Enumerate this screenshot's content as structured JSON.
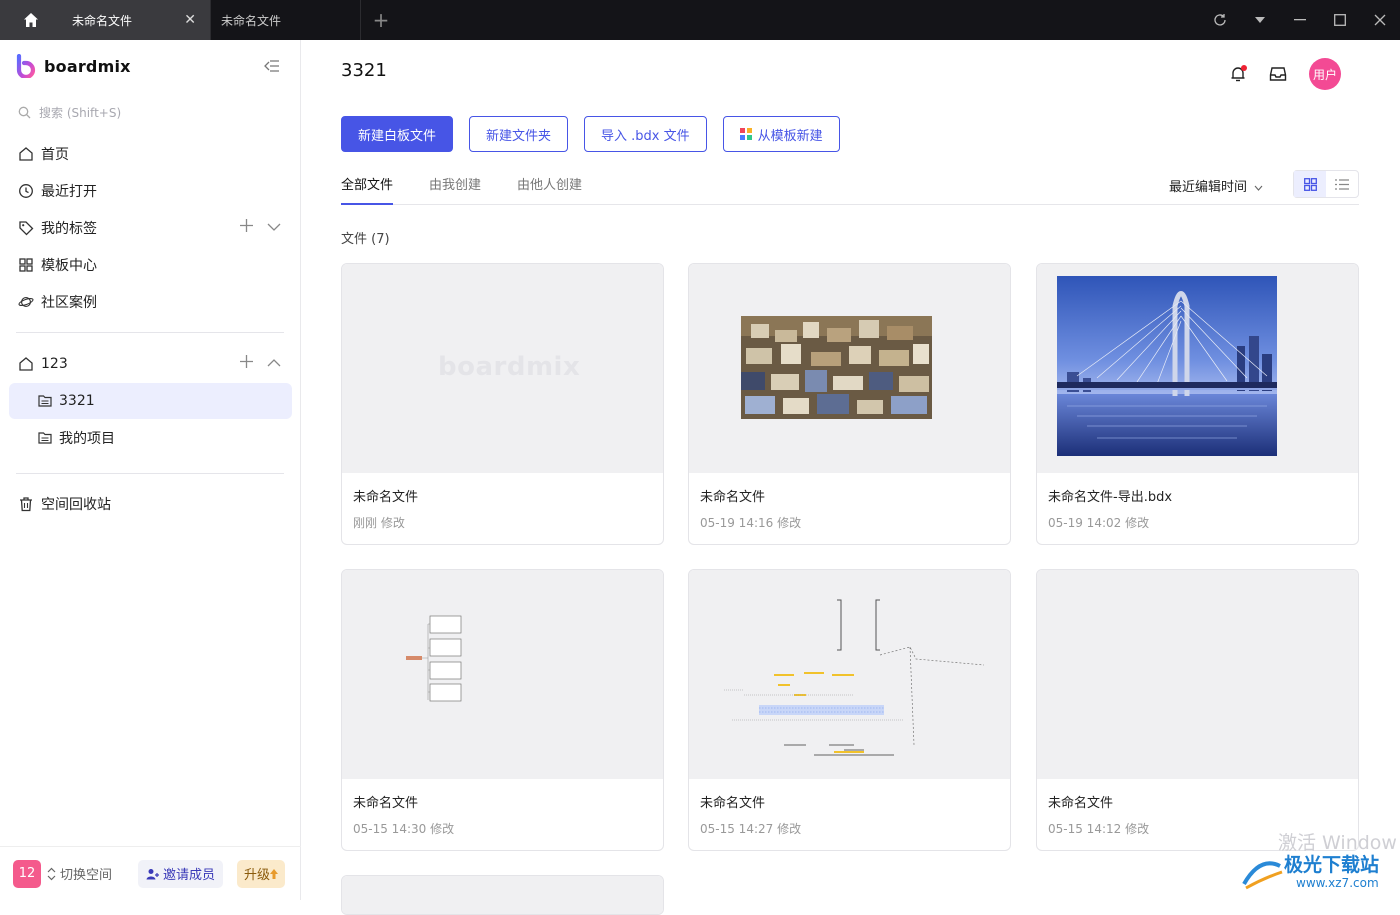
{
  "titlebar": {
    "tabs": [
      {
        "label": "未命名文件",
        "active": true
      },
      {
        "label": "未命名文件",
        "active": false
      }
    ],
    "new_tab": "+"
  },
  "sidebar": {
    "logo_text": "boardmix",
    "search_placeholder": "搜索 (Shift+S)",
    "nav": [
      {
        "label": "首页",
        "icon": "home-icon"
      },
      {
        "label": "最近打开",
        "icon": "clock-icon"
      },
      {
        "label": "我的标签",
        "icon": "tag-icon"
      },
      {
        "label": "模板中心",
        "icon": "grid-icon"
      },
      {
        "label": "社区案例",
        "icon": "planet-icon"
      }
    ],
    "space": {
      "label": "123",
      "icon": "home-icon"
    },
    "projects": [
      {
        "label": "3321",
        "selected": true
      },
      {
        "label": "我的项目",
        "selected": false
      }
    ],
    "trash": "空间回收站",
    "bottom": {
      "space_badge": "12",
      "switch": "切换空间",
      "invite": "邀请成员",
      "upgrade": "升级"
    }
  },
  "main": {
    "title": "3321",
    "avatar_text": "用户",
    "buttons": {
      "new_board": "新建白板文件",
      "new_folder": "新建文件夹",
      "import": "导入 .bdx 文件",
      "from_template": "从模板新建"
    },
    "tabs": [
      {
        "label": "全部文件",
        "active": true
      },
      {
        "label": "由我创建",
        "active": false
      },
      {
        "label": "由他人创建",
        "active": false
      }
    ],
    "sort": "最近编辑时间",
    "file_count": "文件 (7)",
    "files": [
      {
        "name": "未命名文件",
        "meta": "刚刚 修改",
        "thumb": "boardmix-placeholder",
        "placeholder_text": "boardmix"
      },
      {
        "name": "未命名文件",
        "meta": "05-19 14:16 修改",
        "thumb": "city-photo"
      },
      {
        "name": "未命名文件-导出.bdx",
        "meta": "05-19 14:02 修改",
        "thumb": "bridge-photo"
      },
      {
        "name": "未命名文件",
        "meta": "05-15 14:30 修改",
        "thumb": "mindmap-sketch"
      },
      {
        "name": "未命名文件",
        "meta": "05-15 14:27 修改",
        "thumb": "flow-sketch"
      },
      {
        "name": "未命名文件",
        "meta": "05-15 14:12 修改",
        "thumb": "blank"
      }
    ]
  },
  "watermark": {
    "text": "激活 Window",
    "site": "极光下载站",
    "url": "www.xz7.com"
  },
  "colors": {
    "accent": "#4755e6",
    "avatar": "#f34a94",
    "titlebar": "#141418"
  }
}
